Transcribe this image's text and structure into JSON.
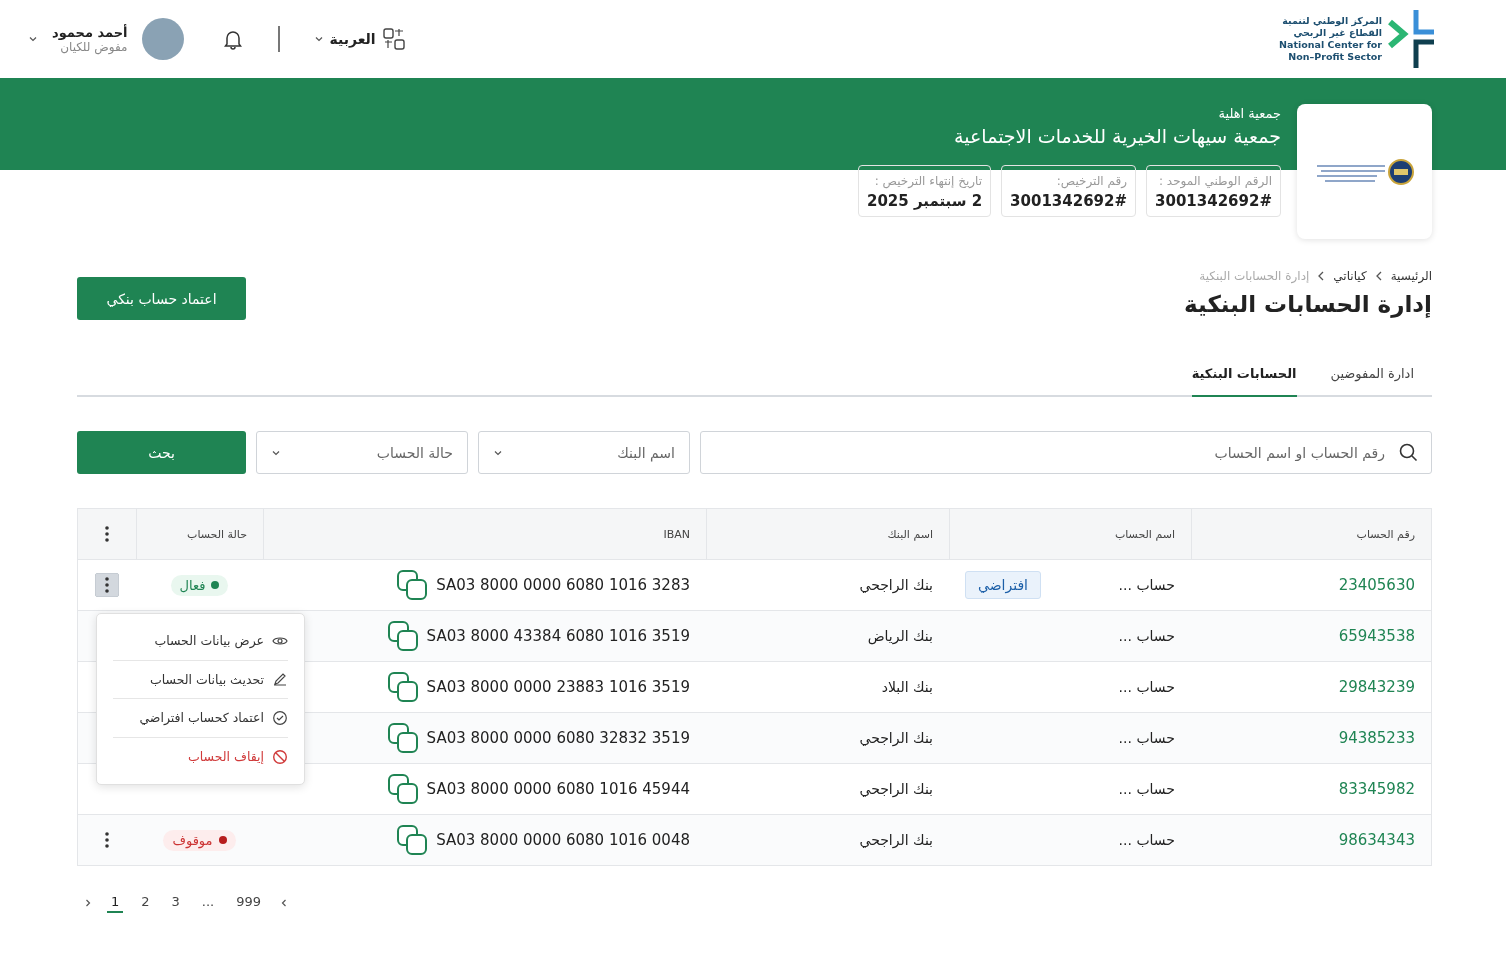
{
  "header": {
    "logo_text": [
      "المركز الوطني لتنمية",
      "القطاع غير الربحي",
      "National Center for",
      "Non–Profit Sector"
    ],
    "language": "العربية",
    "user": {
      "name": "أحمد محمود",
      "role": "مفوض للكيان"
    }
  },
  "organization": {
    "type": "جمعية اهلية",
    "name": "جمعية سيهات الخيرية للخدمات الاجتماعية",
    "info": [
      {
        "label": "الرقم الوطني الموحد :",
        "value": "3001342692#"
      },
      {
        "label": "رقم الترخيص:",
        "value": "3001342692#"
      },
      {
        "label": "تاريخ إنتهاء الترخيص :",
        "value": "2 سبتمبر 2025"
      }
    ]
  },
  "breadcrumb": [
    "الرئيسية",
    "كياناتي",
    "إدارة الحسابات البنكية"
  ],
  "page_title": "إدارة الحسابات البنكية",
  "primary_button": "اعتماد حساب بنكي",
  "tabs": [
    {
      "label": "ادارة المفوضين",
      "selected": false
    },
    {
      "label": "الحسابات البنكية",
      "selected": true
    }
  ],
  "filters": {
    "search_placeholder": "رقم الحساب او اسم الحساب",
    "bank_placeholder": "اسم البنك",
    "status_placeholder": "حالة الحساب",
    "search_button": "بحث"
  },
  "table": {
    "columns": [
      "رقم الحساب",
      "اسم الحساب",
      "اسم البنك",
      "IBAN",
      "حالة الحساب"
    ],
    "rows": [
      {
        "account_number": "23405630",
        "account_name": "حساب ...",
        "badge": "افتراضي",
        "bank": "بنك الراجحي",
        "iban": "SA03 8000 0000 6080 1016 3283",
        "status": {
          "label": "فعال",
          "kind": "active"
        },
        "menu_open": true
      },
      {
        "account_number": "65943538",
        "account_name": "حساب ...",
        "bank": "بنك الرياض",
        "iban": "SA03 8000 43384 6080 1016 3519"
      },
      {
        "account_number": "29843239",
        "account_name": "حساب ...",
        "bank": "بنك البلاد",
        "iban": "SA03 8000 0000 23883 1016 3519"
      },
      {
        "account_number": "94385233",
        "account_name": "حساب ...",
        "bank": "بنك الراجحي",
        "iban": "SA03 8000 0000 6080 32832 3519"
      },
      {
        "account_number": "83345982",
        "account_name": "حساب ...",
        "bank": "بنك الراجحي",
        "iban": "SA03 8000 0000 6080 1016 45944"
      },
      {
        "account_number": "98634343",
        "account_name": "حساب ...",
        "bank": "بنك الراجحي",
        "iban": "SA03 8000 0000 6080 1016 0048",
        "status": {
          "label": "موقوف",
          "kind": "stopped"
        },
        "menu_open": false
      }
    ]
  },
  "row_menu": [
    {
      "label": "عرض بيانات الحساب",
      "kind": "normal"
    },
    {
      "label": "تحديث بيانات الحساب",
      "kind": "normal"
    },
    {
      "label": "اعتماد كحساب افتراضي",
      "kind": "normal"
    },
    {
      "label": "إيقاف الحساب",
      "kind": "danger"
    }
  ],
  "pagination": [
    {
      "label": "999",
      "selected": false
    },
    {
      "label": "...",
      "selected": false
    },
    {
      "label": "3",
      "selected": false
    },
    {
      "label": "2",
      "selected": false
    },
    {
      "label": "1",
      "selected": true
    }
  ]
}
